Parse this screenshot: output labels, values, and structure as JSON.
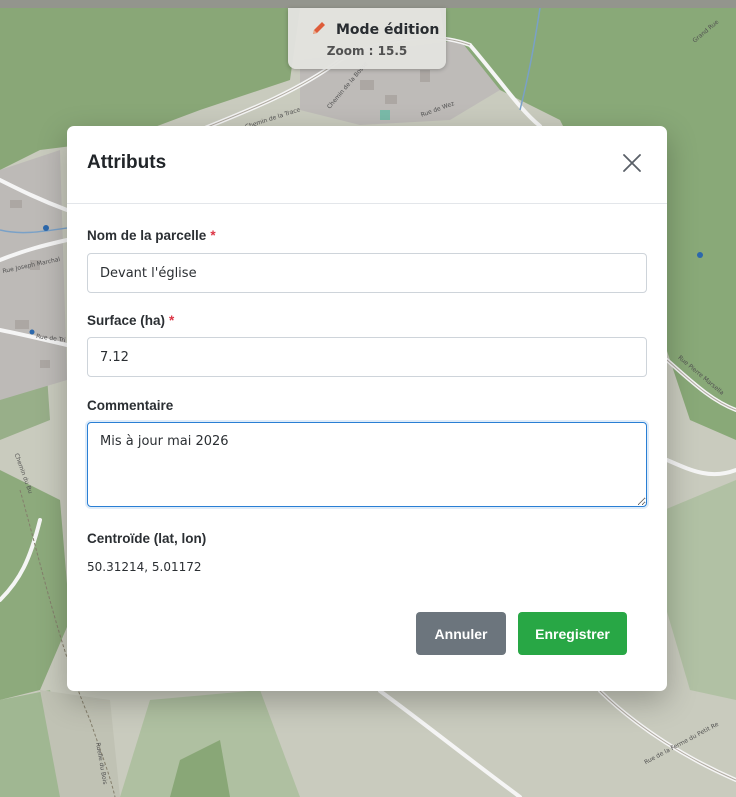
{
  "map": {
    "street_labels": [
      "Chemin de la Trace",
      "Rue de Wez",
      "Rue Joseph Marchal",
      "Rue de Tri",
      "Chemin du Bu",
      "Rue Pierre Marsella",
      "Rue de la Ferme du Petit Re",
      "Grand Rue",
      "Chemin de la Bosse",
      "Ruelle du Bois"
    ]
  },
  "mode": {
    "title": "Mode édition",
    "zoom": "Zoom : 15.5",
    "icon": "pencil-icon",
    "icon_color": "#e8603c"
  },
  "dialog": {
    "title": "Attributs",
    "close_icon": "close-icon",
    "fields": {
      "name": {
        "label": "Nom de la parcelle",
        "required_mark": "*",
        "value": "Devant l'église"
      },
      "surface": {
        "label": "Surface (ha)",
        "required_mark": "*",
        "value": "7.12"
      },
      "comment": {
        "label": "Commentaire",
        "value": "Mis à jour mai 2026"
      },
      "centroid": {
        "label": "Centroïde (lat, lon)",
        "value": "50.31214, 5.01172"
      }
    },
    "buttons": {
      "cancel": "Annuler",
      "save": "Enregistrer"
    }
  },
  "colors": {
    "required": "#dc3545",
    "cancel": "#6c757d",
    "save": "#28a745",
    "focus": "#2a7fd4"
  }
}
